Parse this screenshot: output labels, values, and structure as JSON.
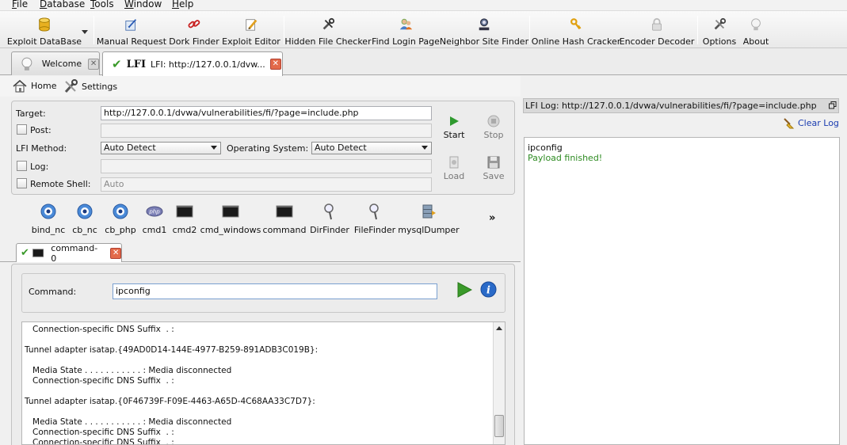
{
  "menu": [
    "File",
    "Database",
    "Tools",
    "Window",
    "Help"
  ],
  "toolbar": [
    {
      "label": "Exploit DataBase",
      "icon": "database-icon"
    },
    {
      "label": "Manual Request",
      "icon": "manual-request-icon"
    },
    {
      "label": "Dork Finder",
      "icon": "link-icon"
    },
    {
      "label": "Exploit Editor",
      "icon": "pencil-icon"
    },
    {
      "label": "Hidden File Checker",
      "icon": "tools-icon"
    },
    {
      "label": "Find Login Page",
      "icon": "users-icon"
    },
    {
      "label": "Neighbor Site Finder",
      "icon": "person-icon"
    },
    {
      "label": "Online Hash Cracker",
      "icon": "key-icon"
    },
    {
      "label": "Encoder Decoder",
      "icon": "lock-icon"
    },
    {
      "label": "Options",
      "icon": "wrench-icon"
    },
    {
      "label": "About",
      "icon": "lightbulb-icon"
    }
  ],
  "tabs": [
    {
      "label": "Welcome"
    },
    {
      "label": "LFI: http://127.0.0.1/dvw...",
      "prefix": "LFI"
    }
  ],
  "home": {
    "home_label": "Home",
    "settings_label": "Settings"
  },
  "form": {
    "target_label": "Target:",
    "target_value": "http://127.0.0.1/dvwa/vulnerabilities/fi/?page=include.php",
    "post_label": "Post:",
    "method_label": "LFI Method:",
    "method_value": "Auto Detect",
    "os_label": "Operating System:",
    "os_value": "Auto Detect",
    "log_label": "Log:",
    "remote_shell_label": "Remote Shell:",
    "remote_shell_value": "Auto",
    "start_label": "Start",
    "stop_label": "Stop",
    "load_label": "Load",
    "save_label": "Save"
  },
  "payloads": [
    "bind_nc",
    "cb_nc",
    "cb_php",
    "cmd1",
    "cmd2",
    "cmd_windows",
    "command",
    "DirFinder",
    "FileFinder",
    "mysqlDumper"
  ],
  "more_label": "»",
  "subtab": {
    "label": "command-0"
  },
  "command": {
    "label": "Command:",
    "value": "ipconfig"
  },
  "console_lines": [
    "   Connection-specific DNS Suffix  . :",
    "",
    "Tunnel adapter isatap.{49AD0D14-144E-4977-B259-891ADB3C019B}:",
    "",
    "   Media State . . . . . . . . . . . : Media disconnected",
    "   Connection-specific DNS Suffix  . :",
    "",
    "Tunnel adapter isatap.{0F46739F-F09E-4463-A65D-4C68AA33C7D7}:",
    "",
    "   Media State . . . . . . . . . . . : Media disconnected",
    "   Connection-specific DNS Suffix  . :",
    "   Connection-specific DNS Suffix  . :"
  ],
  "log": {
    "title": "LFI Log: http://127.0.0.1/dvwa/vulnerabilities/fi/?page=include.php",
    "clear_label": "Clear Log",
    "lines": [
      {
        "text": "ipconfig",
        "color": "#111111"
      },
      {
        "text": "Payload finished!",
        "color": "#2e8b22"
      }
    ]
  }
}
